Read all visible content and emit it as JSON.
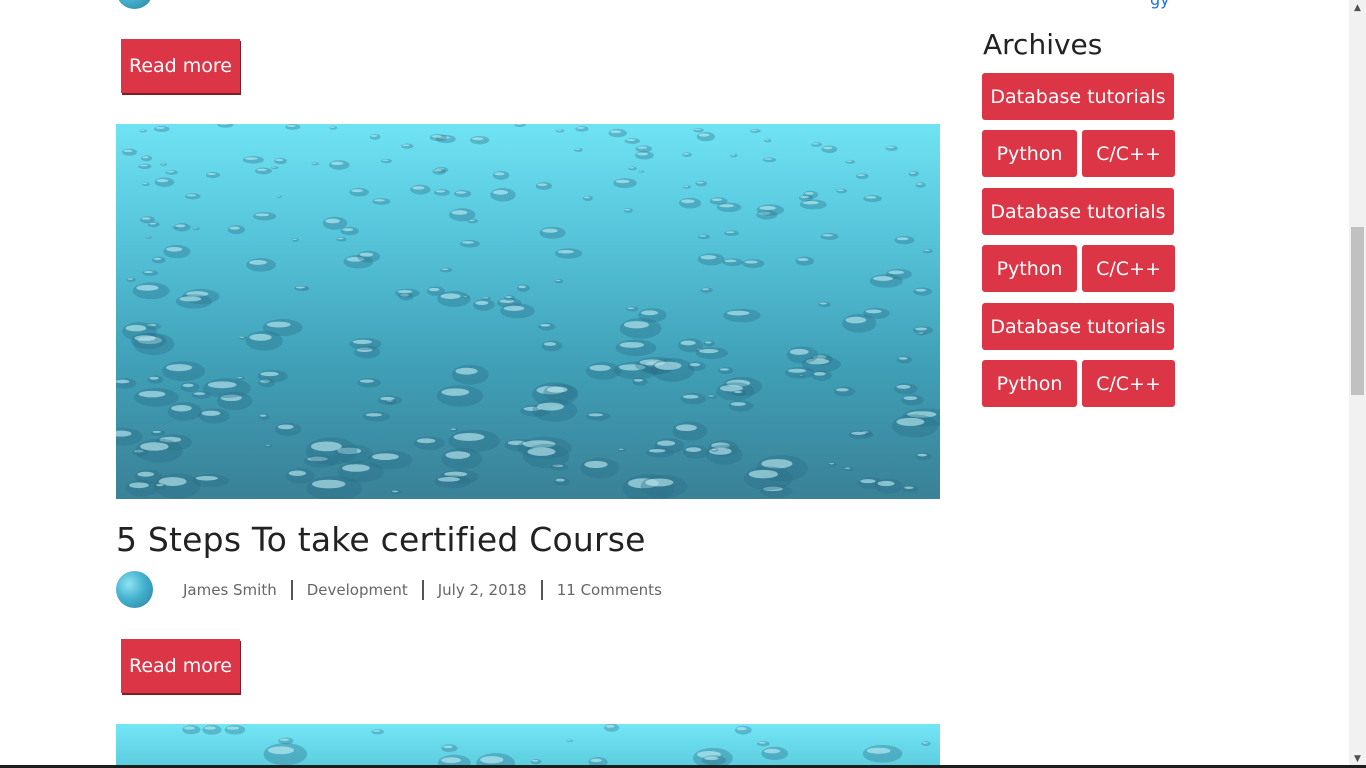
{
  "partial_link": "gy",
  "read_more_label": "Read more",
  "post": {
    "title": "5 Steps To take certified Course",
    "author": "James Smith",
    "category": "Development",
    "date": "July 2, 2018",
    "comments": "11 Comments"
  },
  "sidebar": {
    "title": "Archives",
    "tags": [
      "Database tutorials",
      "Python",
      "C/C++",
      "Database tutorials",
      "Python",
      "C/C++",
      "Database tutorials",
      "Python",
      "C/C++"
    ]
  },
  "colors": {
    "accent": "#dc3545",
    "text": "#212529",
    "meta": "#666666"
  },
  "icons": {
    "scroll_up": "scroll-up-arrow-icon",
    "scroll_down": "scroll-down-arrow-icon"
  }
}
